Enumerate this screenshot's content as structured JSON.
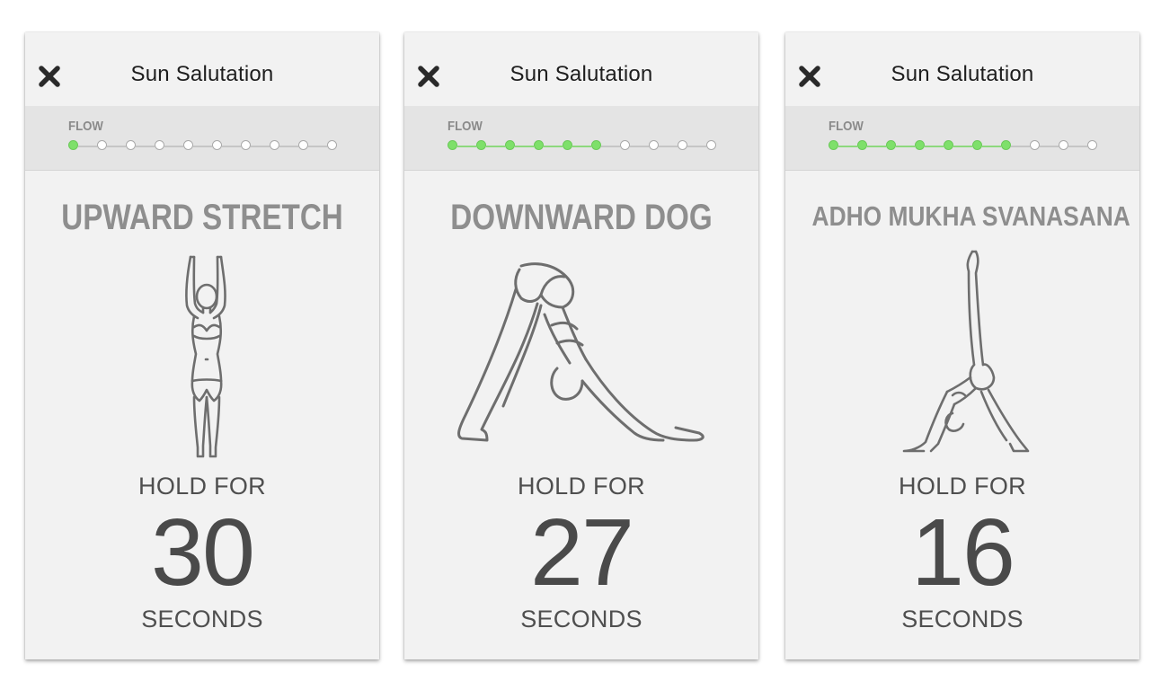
{
  "colors": {
    "completed_step": "#7ee06a",
    "pending_step": "#ffffff",
    "completed_line": "#8ed87e",
    "pending_line": "#c6c6c6"
  },
  "screens": [
    {
      "title": "Sun Salutation",
      "close_icon": "close-icon",
      "flow_label": "FLOW",
      "flow_total_steps": 10,
      "flow_completed_steps": 1,
      "pose_name": "UPWARD STRETCH",
      "pose_icon": "upward-stretch-figure-icon",
      "hold_label": "HOLD FOR",
      "hold_value": "30",
      "hold_unit": "SECONDS"
    },
    {
      "title": "Sun Salutation",
      "close_icon": "close-icon",
      "flow_label": "FLOW",
      "flow_total_steps": 10,
      "flow_completed_steps": 6,
      "pose_name": "DOWNWARD DOG",
      "pose_icon": "downward-dog-figure-icon",
      "hold_label": "HOLD FOR",
      "hold_value": "27",
      "hold_unit": "SECONDS"
    },
    {
      "title": "Sun Salutation",
      "close_icon": "close-icon",
      "flow_label": "FLOW",
      "flow_total_steps": 10,
      "flow_completed_steps": 7,
      "pose_name": "ADHO MUKHA SVANASANA",
      "pose_icon": "three-legged-dog-figure-icon",
      "hold_label": "HOLD FOR",
      "hold_value": "16",
      "hold_unit": "SECONDS"
    }
  ]
}
